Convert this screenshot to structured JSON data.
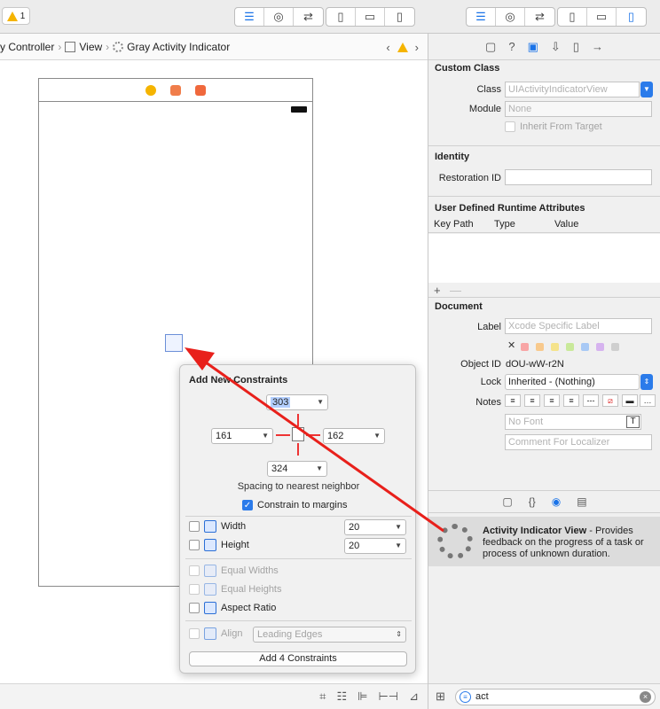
{
  "toolbar": {
    "warning_count": "1",
    "editor_icons": [
      "align-left-icon",
      "circles-icon",
      "swap-arrows-icon"
    ],
    "panel_icons": [
      "left-panel-icon",
      "bottom-panel-icon",
      "right-panel-icon"
    ]
  },
  "breadcrumb": {
    "items": [
      "y Controller",
      "View",
      "Gray Activity Indicator"
    ]
  },
  "popover": {
    "title": "Add New Constraints",
    "top_value": "303",
    "left_value": "161",
    "right_value": "162",
    "bottom_value": "324",
    "spacing_label": "Spacing to nearest neighbor",
    "constrain_margins_label": "Constrain to margins",
    "width_label": "Width",
    "width_value": "20",
    "height_label": "Height",
    "height_value": "20",
    "equal_widths_label": "Equal Widths",
    "equal_heights_label": "Equal Heights",
    "aspect_ratio_label": "Aspect Ratio",
    "align_label": "Align",
    "align_value": "Leading Edges",
    "add_button_label": "Add 4 Constraints"
  },
  "inspector": {
    "custom_class": {
      "title": "Custom Class",
      "class_label": "Class",
      "class_placeholder": "UIActivityIndicatorView",
      "module_label": "Module",
      "module_placeholder": "None",
      "inherit_label": "Inherit From Target"
    },
    "identity": {
      "title": "Identity",
      "restoration_label": "Restoration ID"
    },
    "runtime": {
      "title": "User Defined Runtime Attributes",
      "col_keypath": "Key Path",
      "col_type": "Type",
      "col_value": "Value"
    },
    "document": {
      "title": "Document",
      "label_label": "Label",
      "label_placeholder": "Xcode Specific Label",
      "object_id_label": "Object ID",
      "object_id_value": "dOU-wW-r2N",
      "lock_label": "Lock",
      "lock_value": "Inherited - (Nothing)",
      "notes_label": "Notes",
      "font_placeholder": "No Font",
      "comment_placeholder": "Comment For Localizer"
    },
    "library_item": {
      "title": "Activity Indicator View",
      "description": " - Provides feedback on the progress of a task or process of unknown duration."
    },
    "search_value": "act"
  },
  "colors": {
    "accent": "#2b7bea",
    "arrow": "#e8201b",
    "warning": "#f5b400"
  }
}
